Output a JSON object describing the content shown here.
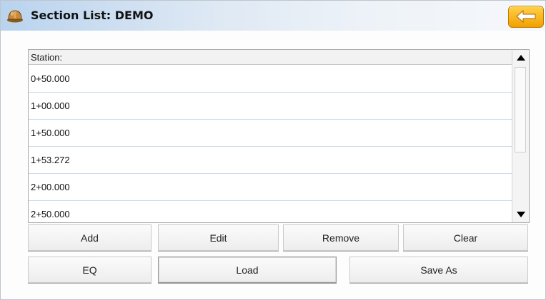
{
  "window": {
    "title": "Section List: DEMO",
    "app_icon": "hardhat-icon",
    "back_icon": "arrow-left-icon"
  },
  "list": {
    "header": "Station:",
    "rows": [
      "0+50.000",
      "1+00.000",
      "1+50.000",
      "1+53.272",
      "2+00.000",
      "2+50.000"
    ]
  },
  "buttons": {
    "add": "Add",
    "edit": "Edit",
    "remove": "Remove",
    "clear": "Clear",
    "eq": "EQ",
    "load": "Load",
    "save_as": "Save As"
  },
  "colors": {
    "title_gradient_start": "#b9d3ee",
    "back_button": "#f1a000",
    "row_divider": "#c7dcef"
  }
}
